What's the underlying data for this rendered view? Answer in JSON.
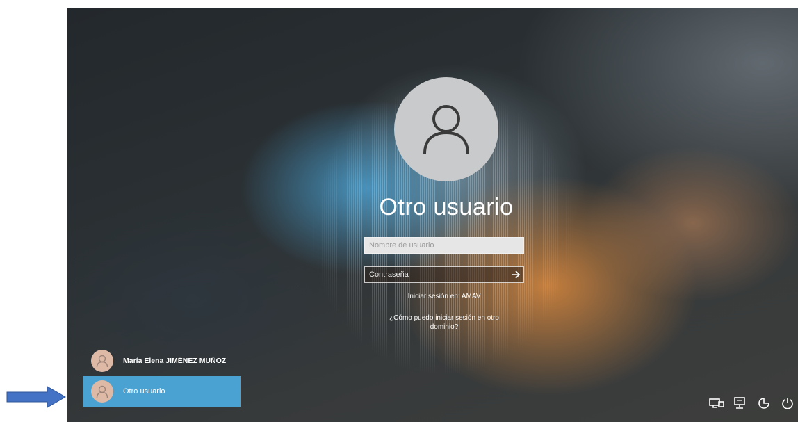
{
  "login": {
    "selected_user": "Otro usuario",
    "username_placeholder": "Nombre de usuario",
    "password_placeholder": "Contraseña",
    "sign_in_domain": "Iniciar sesión en: AMAV",
    "how_to_sign_in": "¿Cómo puedo iniciar sesión en otro dominio?"
  },
  "user_list": [
    {
      "name": "María Elena JIMÉNEZ MUÑOZ",
      "selected": false
    },
    {
      "name": "Otro usuario",
      "selected": true
    }
  ],
  "tray_icons": [
    "network-connection-icon",
    "network-icon",
    "ease-of-access-icon",
    "power-icon"
  ],
  "colors": {
    "selected_user_bg": "#4aa2d2",
    "arrow": "#4472c4"
  }
}
